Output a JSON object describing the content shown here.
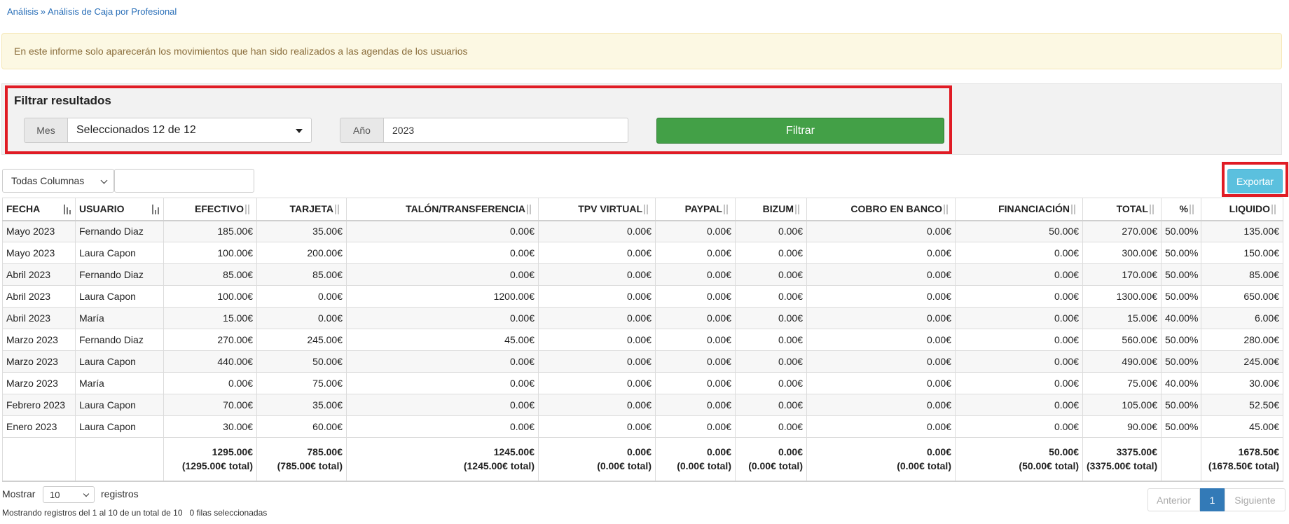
{
  "breadcrumb": {
    "root": "Análisis",
    "separator": "»",
    "current": "Análisis de Caja por Profesional"
  },
  "alert": {
    "text": "En este informe solo aparecerán los movimientos que han sido realizados a las agendas de los usuarios"
  },
  "filter": {
    "title": "Filtrar resultados",
    "mes_label": "Mes",
    "mes_value": "Seleccionados 12 de 12",
    "anio_label": "Año",
    "anio_value": "2023",
    "submit_label": "Filtrar"
  },
  "toolbar": {
    "columns_select": "Todas Columnas",
    "search_value": "",
    "export_label": "Exportar"
  },
  "colors": {
    "accent_green": "#43a047",
    "export_blue": "#5bc0de",
    "highlight_red": "#e01b24",
    "alert_bg": "#fcf8e3"
  },
  "table": {
    "headers": [
      "FECHA",
      "USUARIO",
      "EFECTIVO",
      "TARJETA",
      "TALÓN/TRANSFERENCIA",
      "TPV VIRTUAL",
      "PAYPAL",
      "BIZUM",
      "COBRO EN BANCO",
      "FINANCIACIÓN",
      "TOTAL",
      "%",
      "LIQUIDO"
    ],
    "rows": [
      [
        "Mayo 2023",
        "Fernando Diaz",
        "185.00€",
        "35.00€",
        "0.00€",
        "0.00€",
        "0.00€",
        "0.00€",
        "0.00€",
        "50.00€",
        "270.00€",
        "50.00%",
        "135.00€"
      ],
      [
        "Mayo 2023",
        "Laura Capon",
        "100.00€",
        "200.00€",
        "0.00€",
        "0.00€",
        "0.00€",
        "0.00€",
        "0.00€",
        "0.00€",
        "300.00€",
        "50.00%",
        "150.00€"
      ],
      [
        "Abril 2023",
        "Fernando Diaz",
        "85.00€",
        "85.00€",
        "0.00€",
        "0.00€",
        "0.00€",
        "0.00€",
        "0.00€",
        "0.00€",
        "170.00€",
        "50.00%",
        "85.00€"
      ],
      [
        "Abril 2023",
        "Laura Capon",
        "100.00€",
        "0.00€",
        "1200.00€",
        "0.00€",
        "0.00€",
        "0.00€",
        "0.00€",
        "0.00€",
        "1300.00€",
        "50.00%",
        "650.00€"
      ],
      [
        "Abril 2023",
        "María",
        "15.00€",
        "0.00€",
        "0.00€",
        "0.00€",
        "0.00€",
        "0.00€",
        "0.00€",
        "0.00€",
        "15.00€",
        "40.00%",
        "6.00€"
      ],
      [
        "Marzo 2023",
        "Fernando Diaz",
        "270.00€",
        "245.00€",
        "45.00€",
        "0.00€",
        "0.00€",
        "0.00€",
        "0.00€",
        "0.00€",
        "560.00€",
        "50.00%",
        "280.00€"
      ],
      [
        "Marzo 2023",
        "Laura Capon",
        "440.00€",
        "50.00€",
        "0.00€",
        "0.00€",
        "0.00€",
        "0.00€",
        "0.00€",
        "0.00€",
        "490.00€",
        "50.00%",
        "245.00€"
      ],
      [
        "Marzo 2023",
        "María",
        "0.00€",
        "75.00€",
        "0.00€",
        "0.00€",
        "0.00€",
        "0.00€",
        "0.00€",
        "0.00€",
        "75.00€",
        "40.00%",
        "30.00€"
      ],
      [
        "Febrero 2023",
        "Laura Capon",
        "70.00€",
        "35.00€",
        "0.00€",
        "0.00€",
        "0.00€",
        "0.00€",
        "0.00€",
        "0.00€",
        "105.00€",
        "50.00%",
        "52.50€"
      ],
      [
        "Enero 2023",
        "Laura Capon",
        "30.00€",
        "60.00€",
        "0.00€",
        "0.00€",
        "0.00€",
        "0.00€",
        "0.00€",
        "0.00€",
        "90.00€",
        "50.00%",
        "45.00€"
      ]
    ],
    "totals": [
      [
        "",
        ""
      ],
      [
        "",
        ""
      ],
      [
        "1295.00€",
        "(1295.00€ total)"
      ],
      [
        "785.00€",
        "(785.00€ total)"
      ],
      [
        "1245.00€",
        "(1245.00€ total)"
      ],
      [
        "0.00€",
        "(0.00€ total)"
      ],
      [
        "0.00€",
        "(0.00€ total)"
      ],
      [
        "0.00€",
        "(0.00€ total)"
      ],
      [
        "0.00€",
        "(0.00€ total)"
      ],
      [
        "50.00€",
        "(50.00€ total)"
      ],
      [
        "3375.00€",
        "(3375.00€ total)"
      ],
      [
        "",
        ""
      ],
      [
        "1678.50€",
        "(1678.50€ total)"
      ]
    ]
  },
  "footer": {
    "show_label": "Mostrar",
    "page_length": "10",
    "records_label": "registros",
    "info": "Mostrando registros del 1 al 10 de un total de 10",
    "selected_info": "0 filas seleccionadas",
    "prev_label": "Anterior",
    "current_page": "1",
    "next_label": "Siguiente"
  }
}
